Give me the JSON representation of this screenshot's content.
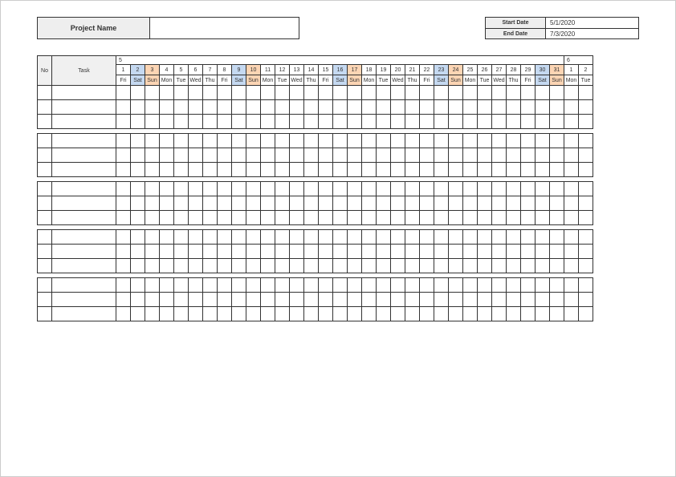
{
  "header": {
    "project_label": "Project Name",
    "project_value": "",
    "start_label": "Start Date",
    "start_value": "5/1/2020",
    "end_label": "End Date",
    "end_value": "7/3/2020"
  },
  "columns": {
    "no": "No",
    "task": "Task"
  },
  "months": [
    {
      "label": "5",
      "span": 31
    },
    {
      "label": "6",
      "span": 2
    }
  ],
  "days": [
    {
      "num": "1",
      "dow": "Fri",
      "type": ""
    },
    {
      "num": "2",
      "dow": "Sat",
      "type": "sat"
    },
    {
      "num": "3",
      "dow": "Sun",
      "type": "sun"
    },
    {
      "num": "4",
      "dow": "Mon",
      "type": ""
    },
    {
      "num": "5",
      "dow": "Tue",
      "type": ""
    },
    {
      "num": "6",
      "dow": "Wed",
      "type": ""
    },
    {
      "num": "7",
      "dow": "Thu",
      "type": ""
    },
    {
      "num": "8",
      "dow": "Fri",
      "type": ""
    },
    {
      "num": "9",
      "dow": "Sat",
      "type": "sat"
    },
    {
      "num": "10",
      "dow": "Sun",
      "type": "sun"
    },
    {
      "num": "11",
      "dow": "Mon",
      "type": ""
    },
    {
      "num": "12",
      "dow": "Tue",
      "type": ""
    },
    {
      "num": "13",
      "dow": "Wed",
      "type": ""
    },
    {
      "num": "14",
      "dow": "Thu",
      "type": ""
    },
    {
      "num": "15",
      "dow": "Fri",
      "type": ""
    },
    {
      "num": "16",
      "dow": "Sat",
      "type": "sat"
    },
    {
      "num": "17",
      "dow": "Sun",
      "type": "sun"
    },
    {
      "num": "18",
      "dow": "Mon",
      "type": ""
    },
    {
      "num": "19",
      "dow": "Tue",
      "type": ""
    },
    {
      "num": "20",
      "dow": "Wed",
      "type": ""
    },
    {
      "num": "21",
      "dow": "Thu",
      "type": ""
    },
    {
      "num": "22",
      "dow": "Fri",
      "type": ""
    },
    {
      "num": "23",
      "dow": "Sat",
      "type": "sat"
    },
    {
      "num": "24",
      "dow": "Sun",
      "type": "sun"
    },
    {
      "num": "25",
      "dow": "Mon",
      "type": ""
    },
    {
      "num": "26",
      "dow": "Tue",
      "type": ""
    },
    {
      "num": "27",
      "dow": "Wed",
      "type": ""
    },
    {
      "num": "28",
      "dow": "Thu",
      "type": ""
    },
    {
      "num": "29",
      "dow": "Fri",
      "type": ""
    },
    {
      "num": "30",
      "dow": "Sat",
      "type": "sat"
    },
    {
      "num": "31",
      "dow": "Sun",
      "type": "sun"
    },
    {
      "num": "1",
      "dow": "Mon",
      "type": ""
    },
    {
      "num": "2",
      "dow": "Tue",
      "type": ""
    }
  ],
  "row_groups": [
    3,
    3,
    3,
    3,
    3
  ]
}
